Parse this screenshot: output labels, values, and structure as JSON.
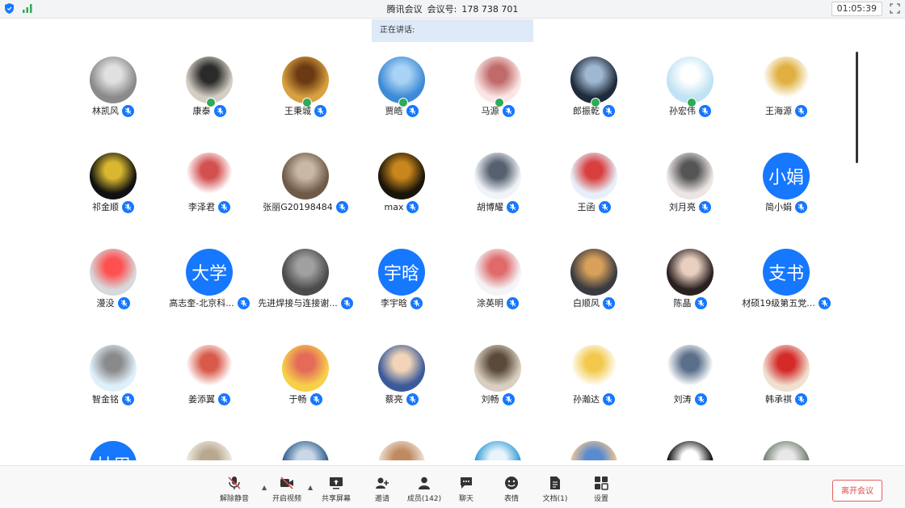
{
  "titlebar": {
    "app": "腾讯会议",
    "meeting_label": "会议号:",
    "meeting_id": "178 738 701",
    "timer": "01:05:39"
  },
  "speaking": {
    "label": "正在讲话:"
  },
  "participants": [
    {
      "name": "林凯风",
      "style": "photo",
      "colors": [
        "#8a8a8a",
        "#e0e0e0"
      ],
      "pin": false
    },
    {
      "name": "康泰",
      "style": "photo",
      "colors": [
        "#d4cfc4",
        "#2a2a2a"
      ],
      "pin": true
    },
    {
      "name": "王秉城",
      "style": "photo",
      "colors": [
        "#d8a040",
        "#6b3a12"
      ],
      "pin": true
    },
    {
      "name": "贾皓",
      "style": "photo",
      "colors": [
        "#3d8ad6",
        "#a9d3f4"
      ],
      "pin": true
    },
    {
      "name": "马源",
      "style": "photo",
      "colors": [
        "#fbe6e6",
        "#c06a6a"
      ],
      "pin": true
    },
    {
      "name": "郎振乾",
      "style": "photo",
      "colors": [
        "#1f2a3a",
        "#9fb7d1"
      ],
      "pin": true
    },
    {
      "name": "孙宏伟",
      "style": "photo",
      "colors": [
        "#bfe2f4",
        "#ffffff"
      ],
      "pin": true
    },
    {
      "name": "王海源",
      "style": "photo",
      "colors": [
        "#ffffff",
        "#e0b040"
      ],
      "pin": false
    },
    {
      "name": "祁金顺",
      "style": "photo",
      "colors": [
        "#111111",
        "#d9b830"
      ],
      "pin": false
    },
    {
      "name": "李泽君",
      "style": "photo",
      "colors": [
        "#ffffff",
        "#d35050"
      ],
      "pin": false
    },
    {
      "name": "张丽G20198484",
      "style": "photo",
      "colors": [
        "#6e5a46",
        "#c8b8a4"
      ],
      "pin": false
    },
    {
      "name": "max",
      "style": "photo",
      "colors": [
        "#1b1408",
        "#c8861c"
      ],
      "pin": false
    },
    {
      "name": "胡博耀",
      "style": "photo",
      "colors": [
        "#f0f4f8",
        "#556070"
      ],
      "pin": false
    },
    {
      "name": "王函",
      "style": "photo",
      "colors": [
        "#e6f0fa",
        "#d84040"
      ],
      "pin": false
    },
    {
      "name": "刘月亮",
      "style": "photo",
      "colors": [
        "#ebe6e4",
        "#555555"
      ],
      "pin": false
    },
    {
      "name": "简小娟",
      "style": "text",
      "label": "小娟",
      "pin": false
    },
    {
      "name": "漫没",
      "style": "photo",
      "colors": [
        "#d7d9dc",
        "#ff5050"
      ],
      "pin": false
    },
    {
      "name": "高志奎-北京科...",
      "style": "text",
      "label": "大学",
      "pin": false
    },
    {
      "name": "先进焊接与连接谢...",
      "style": "photo",
      "colors": [
        "#4b4b4b",
        "#a0a0a0"
      ],
      "pin": false
    },
    {
      "name": "李宇晗",
      "style": "text",
      "label": "宇晗",
      "pin": false
    },
    {
      "name": "涂英明",
      "style": "photo",
      "colors": [
        "#f4f4f8",
        "#e06a6a"
      ],
      "pin": false
    },
    {
      "name": "白顺风",
      "style": "photo",
      "colors": [
        "#3a3a42",
        "#d8a05a"
      ],
      "pin": false
    },
    {
      "name": "陈晶",
      "style": "photo",
      "colors": [
        "#2a2020",
        "#e8cfc0"
      ],
      "pin": false
    },
    {
      "name": "材硕19级第五党...",
      "style": "text",
      "label": "支书",
      "pin": false
    },
    {
      "name": "智金铭",
      "style": "photo",
      "colors": [
        "#dff0fa",
        "#8a8a8a"
      ],
      "pin": false
    },
    {
      "name": "姜添翼",
      "style": "photo",
      "colors": [
        "#ffffff",
        "#d85a4a"
      ],
      "pin": false
    },
    {
      "name": "于畅",
      "style": "photo",
      "colors": [
        "#f7d04a",
        "#e46a5a"
      ],
      "pin": false
    },
    {
      "name": "蔡亮",
      "style": "photo",
      "colors": [
        "#3a5a9a",
        "#f2d5b8"
      ],
      "pin": false
    },
    {
      "name": "刘畅",
      "style": "photo",
      "colors": [
        "#d9cfc0",
        "#5a4a3a"
      ],
      "pin": false
    },
    {
      "name": "孙瀚达",
      "style": "photo",
      "colors": [
        "#ffffff",
        "#f2c94c"
      ],
      "pin": false
    },
    {
      "name": "刘涛",
      "style": "photo",
      "colors": [
        "#ffffff",
        "#5a6f8a"
      ],
      "pin": false
    },
    {
      "name": "韩承祺",
      "style": "photo",
      "colors": [
        "#f0e0d0",
        "#d42a2a"
      ],
      "pin": false
    },
    {
      "name": "",
      "style": "text",
      "label": "林周",
      "pin": false
    },
    {
      "name": "",
      "style": "photo",
      "colors": [
        "#f2ede6",
        "#b8a890"
      ],
      "pin": false
    },
    {
      "name": "",
      "style": "photo",
      "colors": [
        "#2a5a8a",
        "#c8d8e8"
      ],
      "pin": false
    },
    {
      "name": "",
      "style": "photo",
      "colors": [
        "#f0e4d8",
        "#c08a60"
      ],
      "pin": false
    },
    {
      "name": "",
      "style": "photo",
      "colors": [
        "#2a9ad8",
        "#e8f4fa"
      ],
      "pin": false
    },
    {
      "name": "",
      "style": "photo",
      "colors": [
        "#f0c890",
        "#5a8ad0"
      ],
      "pin": false
    },
    {
      "name": "",
      "style": "photo",
      "colors": [
        "#000000",
        "#ffffff"
      ],
      "pin": false
    },
    {
      "name": "",
      "style": "photo",
      "colors": [
        "#6a7a6a",
        "#e8e8e8"
      ],
      "pin": false
    }
  ],
  "toolbar": {
    "unmute": "解除静音",
    "video": "开启视频",
    "share": "共享屏幕",
    "invite": "邀请",
    "members": "成员(142)",
    "chat": "聊天",
    "reaction": "表情",
    "docs": "文档(1)",
    "settings": "设置",
    "leave": "离开会议"
  },
  "colors": {
    "accent": "#1677ff",
    "leave": "#e04a4a"
  }
}
